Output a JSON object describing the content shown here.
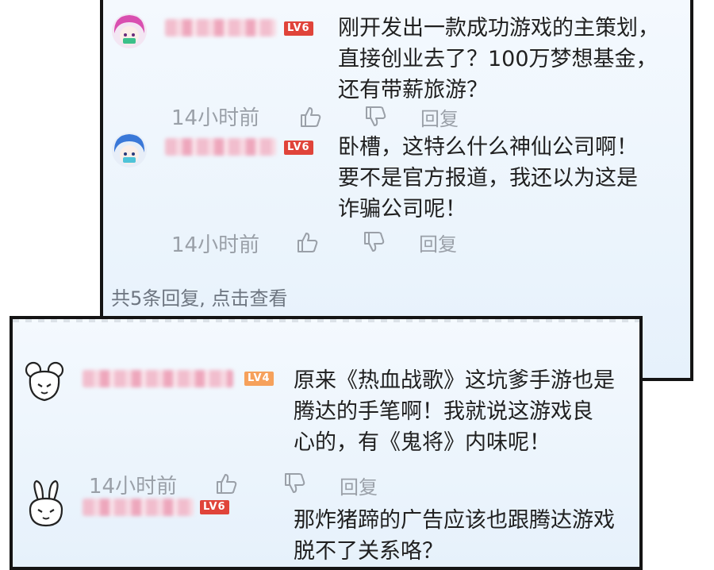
{
  "comments": [
    {
      "level": "LV6",
      "text": "刚开发出一款成功游戏的主策划，\n直接创业去了？100万梦想基金，\n还有带薪旅游？",
      "time": "14小时前",
      "reply": "回复"
    },
    {
      "level": "LV6",
      "text": "卧槽，这特么什么神仙公司啊！\n要不是官方报道，我还以为这是\n诈骗公司呢！",
      "time": "14小时前",
      "reply": "回复"
    },
    {
      "level": "LV4",
      "text": "原来《热血战歌》这坑爹手游也是\n腾达的手笔啊！我就说这游戏良\n心的，有《鬼将》内味呢！",
      "time": "14小时前",
      "reply": "回复"
    },
    {
      "level": "LV6",
      "text": "那炸猪蹄的广告应该也跟腾达游戏\n脱不了关系咯？"
    }
  ],
  "view_more": "共5条回复, 点击查看",
  "colors": {
    "level_red": "#e0443a",
    "level_orange": "#f6a15b",
    "meta_gray": "#9aa0a8",
    "panel_border": "#141414"
  },
  "icons": [
    "thumbs-up-icon",
    "thumbs-down-icon"
  ]
}
